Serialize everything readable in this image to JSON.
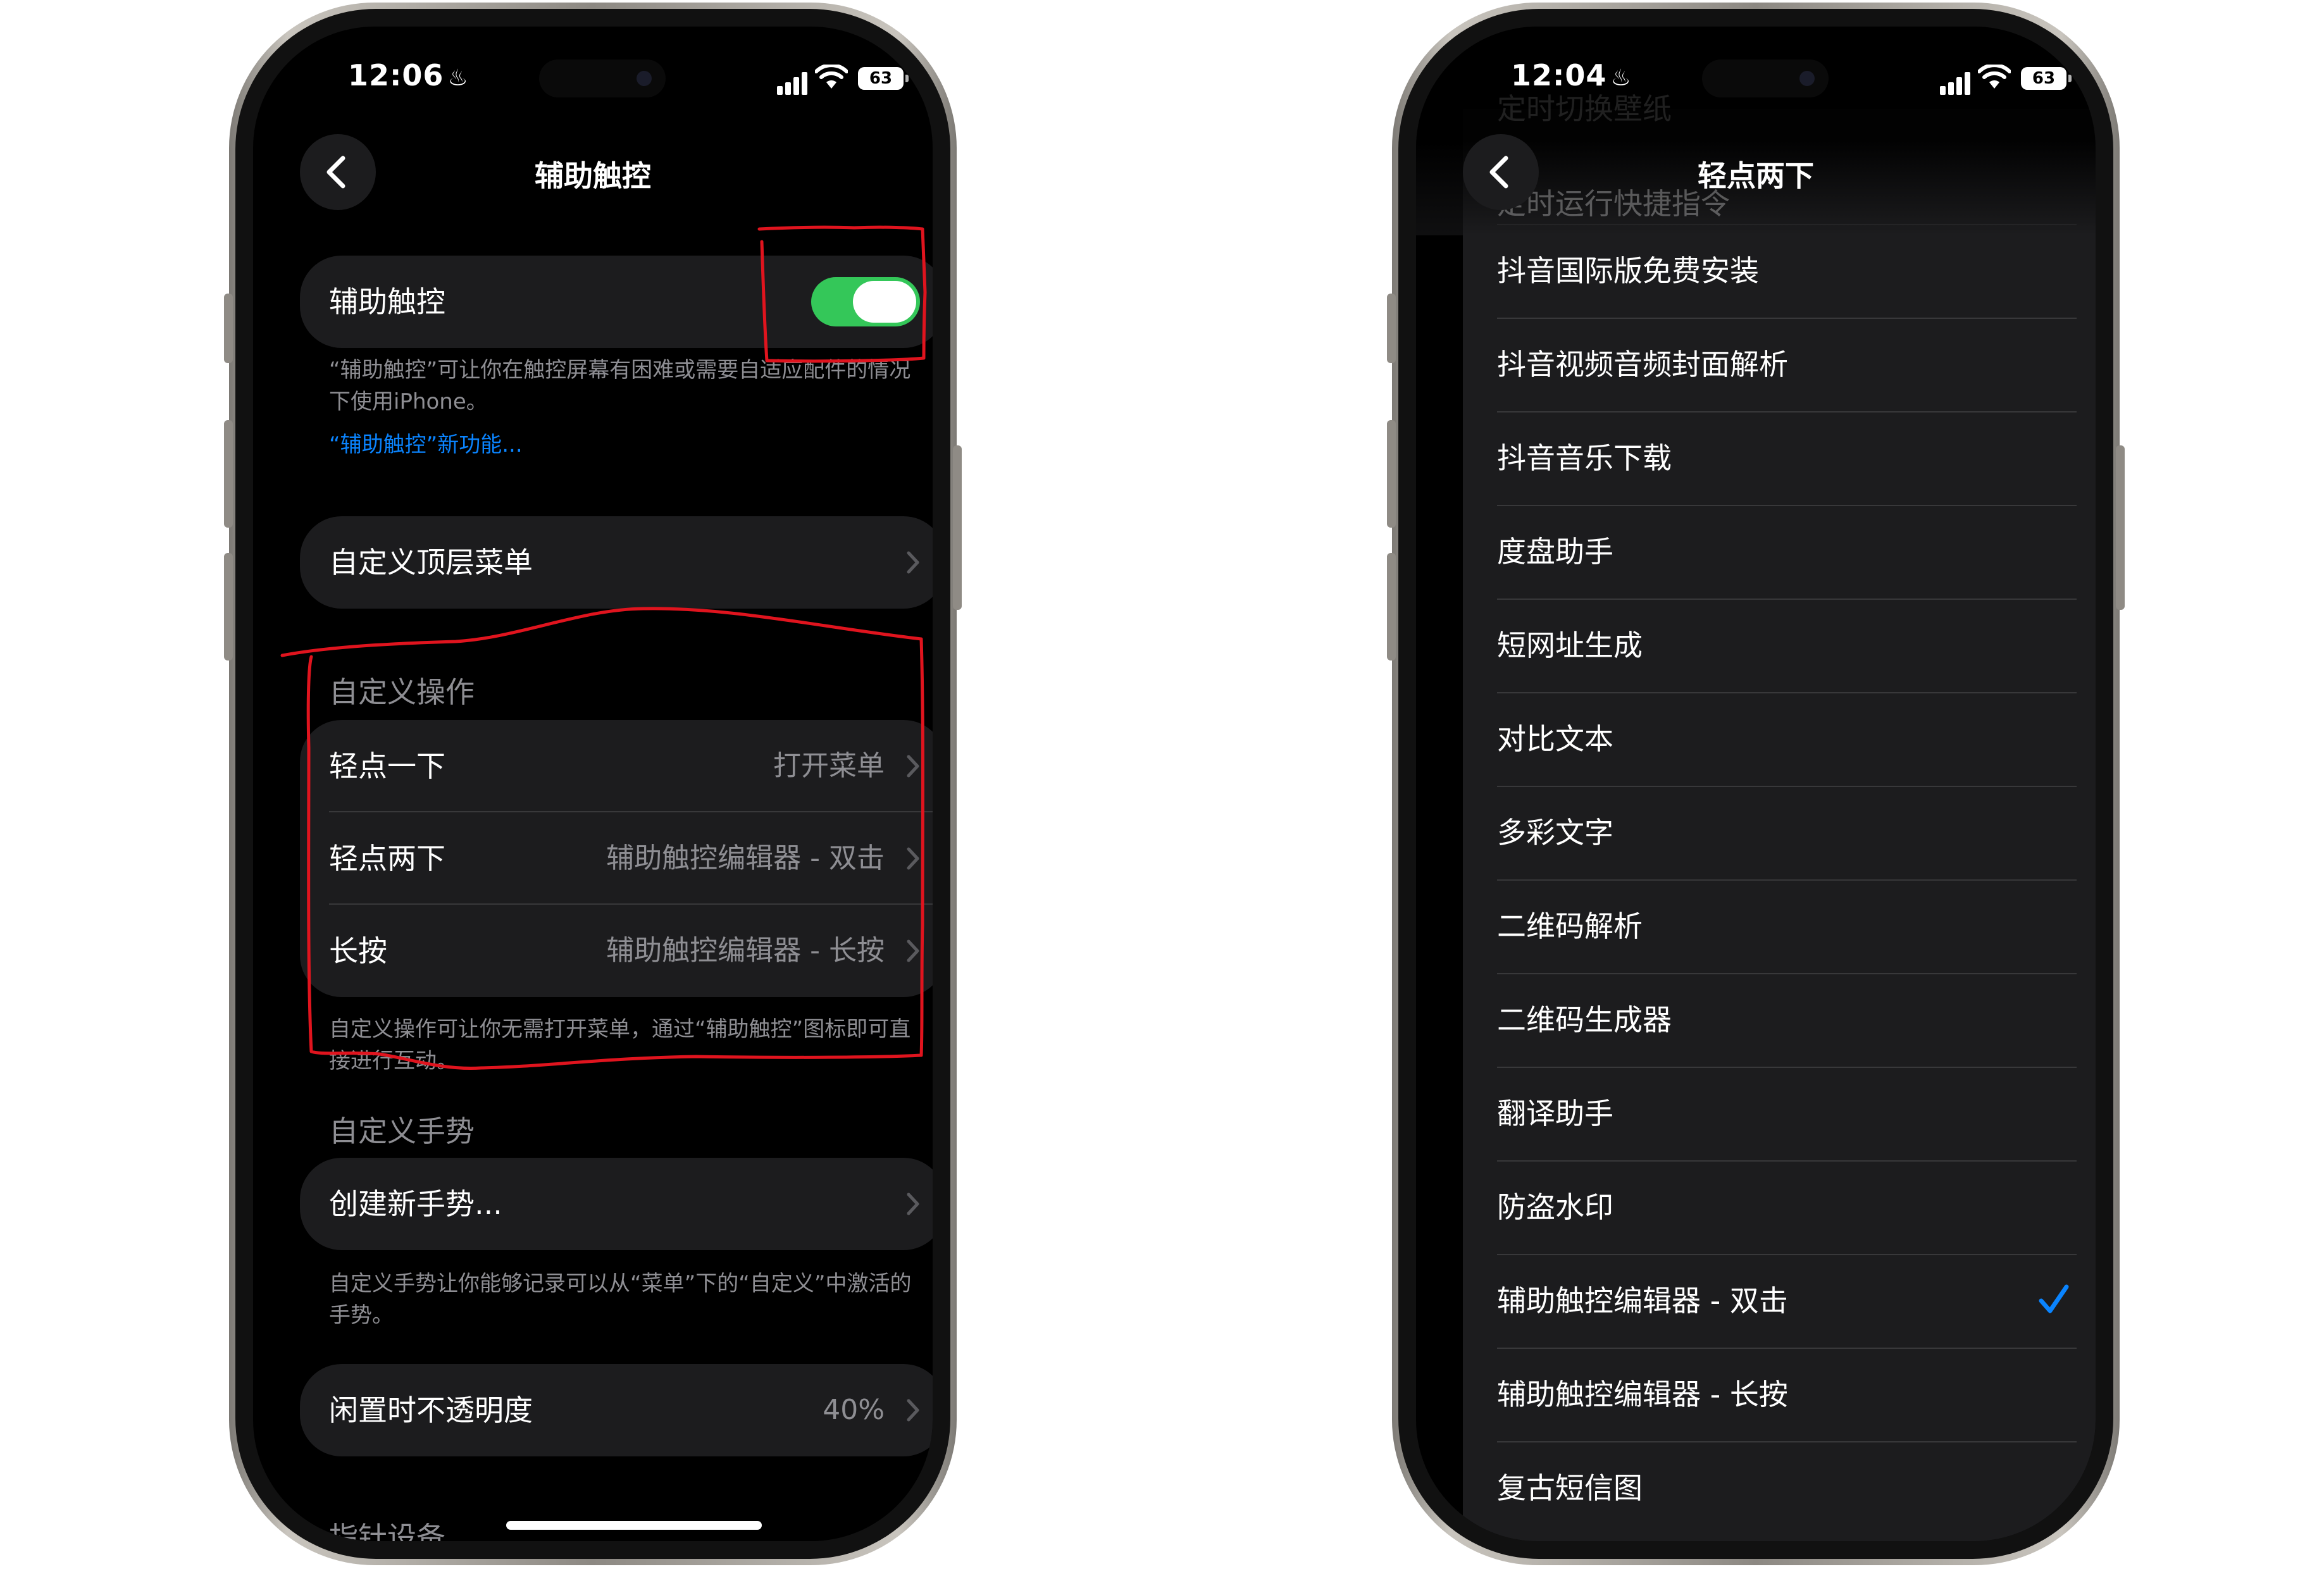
{
  "left_phone": {
    "status": {
      "time": "12:06",
      "battery": "63"
    },
    "nav": {
      "title": "辅助触控"
    },
    "toggle_row": {
      "label": "辅助触控",
      "on": true,
      "color": "#34c759"
    },
    "toggle_footer": {
      "text": "“辅助触控”可让你在触控屏幕有困难或需要自适应配件的情况下使用iPhone。",
      "link": "“辅助触控”新功能..."
    },
    "top_menu": {
      "label": "自定义顶层菜单"
    },
    "custom_actions": {
      "header": "自定义操作",
      "rows": [
        {
          "label": "轻点一下",
          "value": "打开菜单"
        },
        {
          "label": "轻点两下",
          "value": "辅助触控编辑器 - 双击"
        },
        {
          "label": "长按",
          "value": "辅助触控编辑器 - 长按"
        }
      ],
      "footer": "自定义操作可让你无需打开菜单，通过“辅助触控”图标即可直接进行互动。"
    },
    "custom_gestures": {
      "header": "自定义手势",
      "row": {
        "label": "创建新手势..."
      },
      "footer": "自定义手势让你能够记录可以从“菜单”下的“自定义”中激活的手势。"
    },
    "idle_opacity": {
      "label": "闲置时不透明度",
      "value": "40%"
    },
    "pointer_header": "指针设备"
  },
  "right_phone": {
    "status": {
      "time": "12:04",
      "battery": "63"
    },
    "nav": {
      "title": "轻点两下"
    },
    "faded_above": [
      "定时切换壁纸",
      "定时运行快捷指令"
    ],
    "items": [
      {
        "label": "抖音国际版免费安装",
        "checked": false
      },
      {
        "label": "抖音视频音频封面解析",
        "checked": false
      },
      {
        "label": "抖音音乐下载",
        "checked": false
      },
      {
        "label": "度盘助手",
        "checked": false
      },
      {
        "label": "短网址生成",
        "checked": false
      },
      {
        "label": "对比文本",
        "checked": false
      },
      {
        "label": "多彩文字",
        "checked": false
      },
      {
        "label": "二维码解析",
        "checked": false
      },
      {
        "label": "二维码生成器",
        "checked": false
      },
      {
        "label": "翻译助手",
        "checked": false
      },
      {
        "label": "防盗水印",
        "checked": false
      },
      {
        "label": "辅助触控编辑器 - 双击",
        "checked": true
      },
      {
        "label": "辅助触控编辑器 - 长按",
        "checked": false
      },
      {
        "label": "复古短信图",
        "checked": false
      }
    ],
    "check_color": "#0a84ff"
  },
  "annotation": {
    "color": "#e0141e"
  }
}
